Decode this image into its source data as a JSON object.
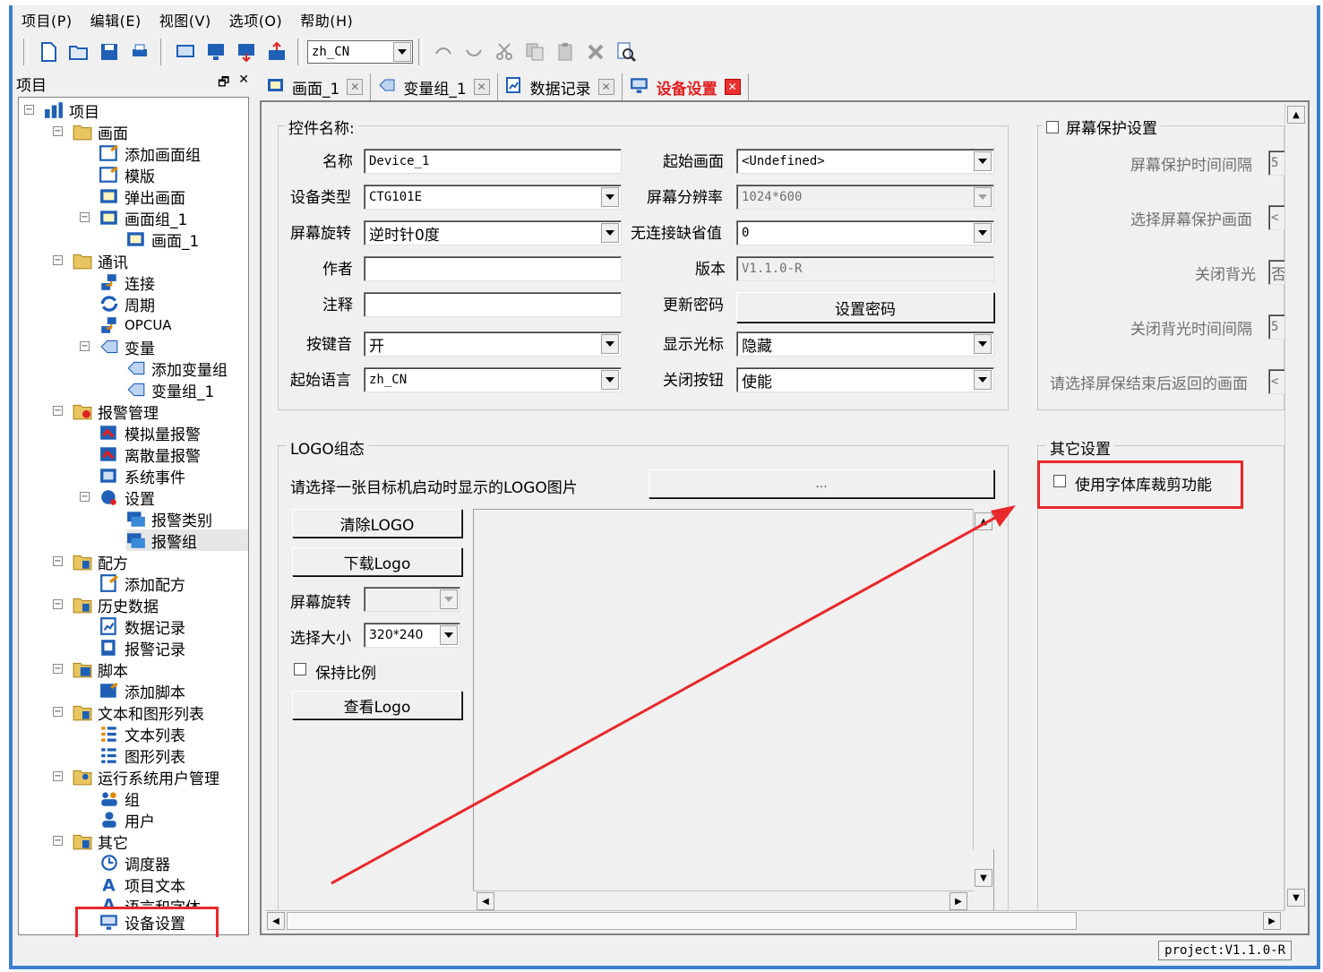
{
  "menu": [
    "项目(P)",
    "编辑(E)",
    "视图(V)",
    "选项(O)",
    "帮助(H)"
  ],
  "toolbar": {
    "language_value": "zh_CN"
  },
  "project_panel": {
    "title": "项目",
    "pin": "🗗",
    "close": "✕"
  },
  "tree": {
    "root": "项目",
    "screen": "画面",
    "add_screen_group": "添加画面组",
    "template": "模版",
    "popup": "弹出画面",
    "screen_group_1": "画面组_1",
    "screen_1": "画面_1",
    "comm": "通讯",
    "connect": "连接",
    "period": "周期",
    "opcua": "OPCUA",
    "variable": "变量",
    "add_var_group": "添加变量组",
    "var_group_1": "变量组_1",
    "alarm_mgmt": "报警管理",
    "analog_alarm": "模拟量报警",
    "discrete_alarm": "离散量报警",
    "sys_event": "系统事件",
    "settings": "设置",
    "alarm_class": "报警类别",
    "alarm_group": "报警组",
    "recipe": "配方",
    "add_recipe": "添加配方",
    "history": "历史数据",
    "data_log": "数据记录",
    "alarm_log": "报警记录",
    "script": "脚本",
    "add_script": "添加脚本",
    "text_graphic_list": "文本和图形列表",
    "text_list": "文本列表",
    "graphic_list": "图形列表",
    "runtime_user_mgmt": "运行系统用户管理",
    "group": "组",
    "user": "用户",
    "other": "其它",
    "scheduler": "调度器",
    "project_text": "项目文本",
    "lang_font": "语言和字体",
    "device_settings": "设备设置"
  },
  "tabs": [
    {
      "label": "画面_1"
    },
    {
      "label": "变量组_1"
    },
    {
      "label": "数据记录"
    },
    {
      "label": "设备设置"
    }
  ],
  "control": {
    "legend": "控件名称:",
    "name_label": "名称",
    "name_value": "Device_1",
    "device_type_label": "设备类型",
    "device_type_value": "CTG101E",
    "rotation_label": "屏幕旋转",
    "rotation_value": "逆时针0度",
    "author_label": "作者",
    "author_value": "",
    "comment_label": "注释",
    "comment_value": "",
    "keysound_label": "按键音",
    "keysound_value": "开",
    "start_lang_label": "起始语言",
    "start_lang_value": "zh_CN",
    "start_screen_label": "起始画面",
    "start_screen_value": "<Undefined>",
    "resolution_label": "屏幕分辨率",
    "resolution_value": "1024*600",
    "no_conn_default_label": "无连接缺省值",
    "no_conn_default_value": "0",
    "version_label": "版本",
    "version_value": "V1.1.0-R",
    "update_pwd_label": "更新密码",
    "set_pwd_button": "设置密码",
    "show_cursor_label": "显示光标",
    "show_cursor_value": "隐藏",
    "close_button_label": "关闭按钮",
    "close_button_value": "使能"
  },
  "screensaver": {
    "legend": "屏幕保护设置",
    "interval_label": "屏幕保护时间间隔",
    "interval_value": "5",
    "select_screen_label": "选择屏幕保护画面",
    "select_screen_value": "<",
    "backlight_off_label": "关闭背光",
    "backlight_off_value": "否",
    "backlight_interval_label": "关闭背光时间间隔",
    "backlight_interval_value": "5",
    "return_screen_label": "请选择屏保结束后返回的画面",
    "return_screen_value": "<"
  },
  "logo": {
    "legend": "LOGO组态",
    "prompt": "请选择一张目标机启动时显示的LOGO图片",
    "browse": "...",
    "clear_button": "清除LOGO",
    "download_button": "下载Logo",
    "rotation_label": "屏幕旋转",
    "rotation_value": "",
    "size_label": "选择大小",
    "size_value": "320*240",
    "keep_ratio_label": "保持比例",
    "view_button": "查看Logo"
  },
  "other_settings": {
    "legend": "其它设置",
    "font_clip_label": "使用字体库裁剪功能"
  },
  "status": {
    "text": "project:V1.1.0-R"
  },
  "colors": {
    "highlight_red": "#e8282a",
    "window_blue": "#3b7fd0"
  }
}
